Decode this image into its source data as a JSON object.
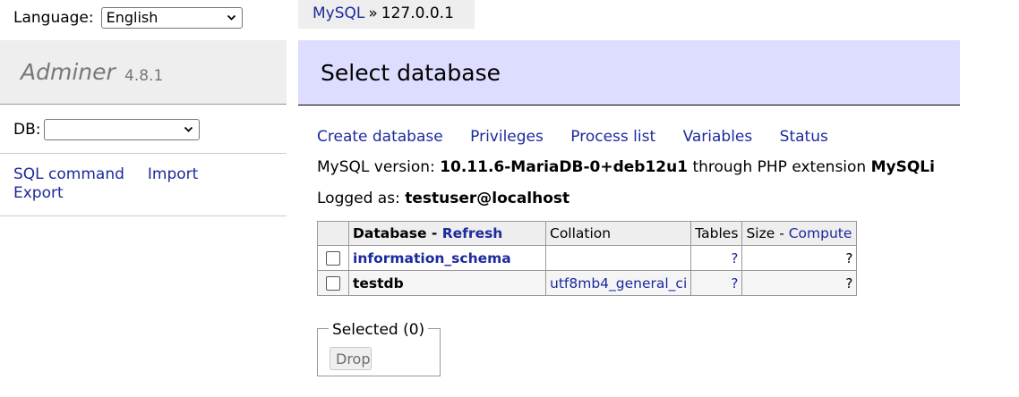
{
  "sidebar": {
    "language_label": "Language:",
    "language_value": "English",
    "app_name": "Adminer",
    "app_version": "4.8.1",
    "db_label": "DB:",
    "db_value": "",
    "links": {
      "sql_command": "SQL command",
      "import": "Import",
      "export": "Export"
    }
  },
  "breadcrumb": {
    "server_type": "MySQL",
    "separator": "»",
    "host": "127.0.0.1"
  },
  "page_title": "Select database",
  "actions": {
    "create_database": "Create database",
    "privileges": "Privileges",
    "process_list": "Process list",
    "variables": "Variables",
    "status": "Status"
  },
  "info": {
    "version_prefix": "MySQL version:",
    "version": "10.11.6-MariaDB-0+deb12u1",
    "through": "through PHP extension",
    "extension": "MySQLi",
    "logged_prefix": "Logged as:",
    "user": "testuser@localhost"
  },
  "table": {
    "headers": {
      "database": "Database",
      "dash": " - ",
      "refresh": "Refresh",
      "collation": "Collation",
      "tables": "Tables",
      "size": "Size",
      "compute": "Compute"
    },
    "rows": [
      {
        "name": "information_schema",
        "collation": "",
        "tables": "?",
        "size": "?"
      },
      {
        "name": "testdb",
        "collation": "utf8mb4_general_ci",
        "tables": "?",
        "size": "?"
      }
    ]
  },
  "selected": {
    "legend": "Selected (0)",
    "drop_label": "Drop"
  },
  "colors": {
    "link": "#1c2a9c",
    "title_bg": "#ddddff",
    "panel_bg": "#eeeeee"
  }
}
